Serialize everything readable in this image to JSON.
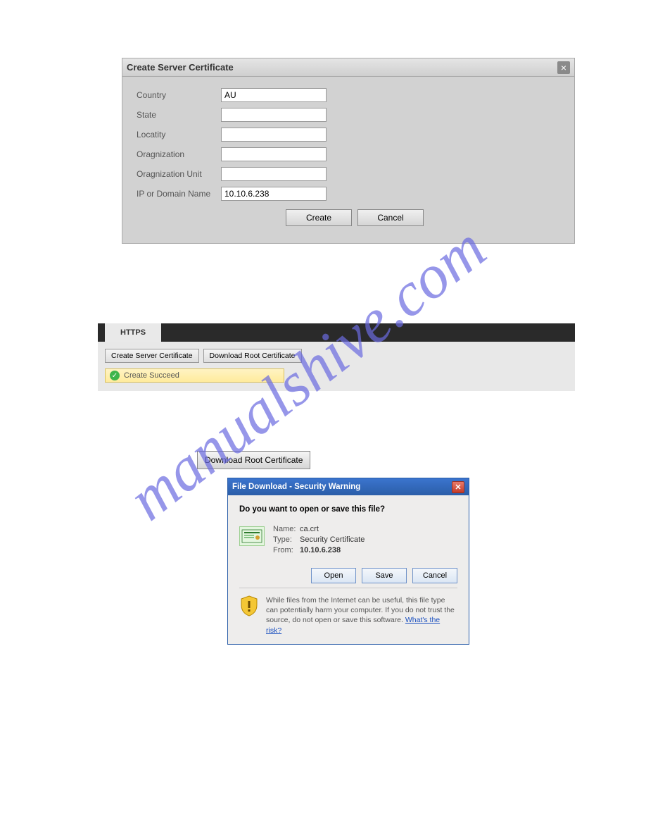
{
  "dialog1": {
    "title": "Create Server Certificate",
    "fields": {
      "country": {
        "label": "Country",
        "value": "AU"
      },
      "state": {
        "label": "State",
        "value": ""
      },
      "locality": {
        "label": "Locatity",
        "value": ""
      },
      "organization": {
        "label": "Oragnization",
        "value": ""
      },
      "organization_unit": {
        "label": "Oragnization Unit",
        "value": ""
      },
      "ip_domain": {
        "label": "IP or Domain Name",
        "value": "10.10.6.238"
      }
    },
    "buttons": {
      "create": "Create",
      "cancel": "Cancel"
    }
  },
  "tabpanel": {
    "tab_label": "HTTPS",
    "buttons": {
      "create_cert": "Create Server Certificate",
      "download_root": "Download Root Certificate"
    },
    "status_text": "Create Succeed"
  },
  "download_button": {
    "label": "Download Root Certificate"
  },
  "file_download": {
    "title": "File Download - Security Warning",
    "prompt": "Do you want to open or save this file?",
    "labels": {
      "name": "Name:",
      "type": "Type:",
      "from": "From:"
    },
    "values": {
      "name": "ca.crt",
      "type": "Security Certificate",
      "from": "10.10.6.238"
    },
    "buttons": {
      "open": "Open",
      "save": "Save",
      "cancel": "Cancel"
    },
    "warning_text": "While files from the Internet can be useful, this file type can potentially harm your computer. If you do not trust the source, do not open or save this software. ",
    "warning_link": "What's the risk?"
  },
  "watermark": "manualshive.com"
}
